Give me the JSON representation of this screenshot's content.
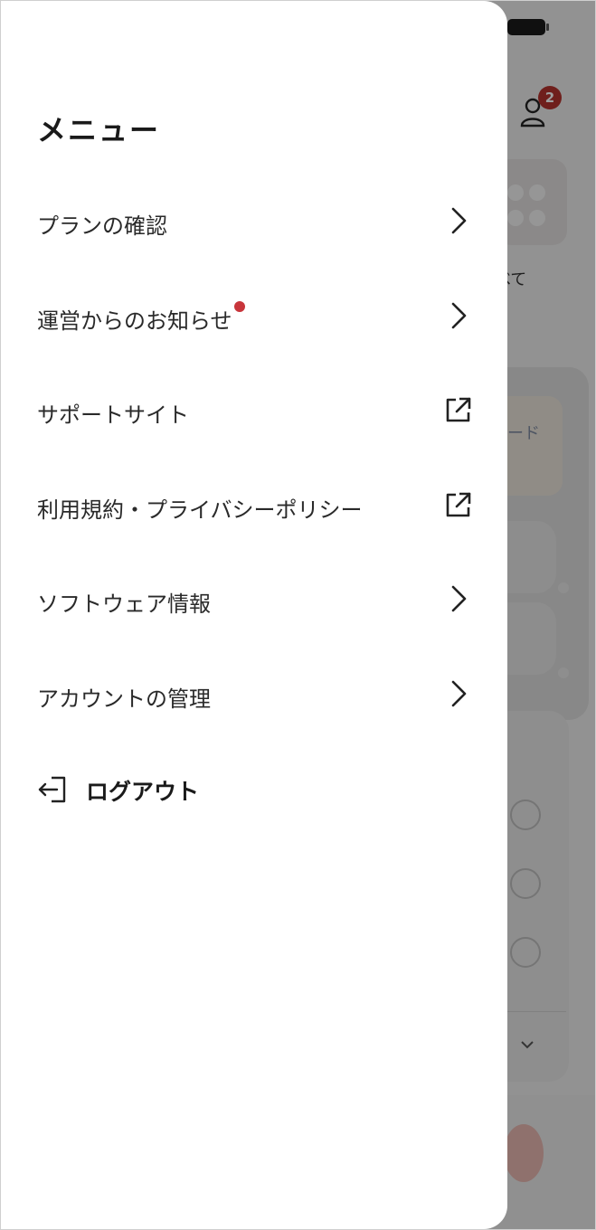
{
  "drawer": {
    "title": "メニュー",
    "items": [
      {
        "label": "プランの確認",
        "icon": "chevron-right-icon",
        "has_badge": false
      },
      {
        "label": "運営からのお知らせ",
        "icon": "chevron-right-icon",
        "has_badge": true
      },
      {
        "label": "サポートサイト",
        "icon": "external-link-icon",
        "has_badge": false
      },
      {
        "label": "利用規約・プライバシーポリシー",
        "icon": "external-link-icon",
        "has_badge": false
      },
      {
        "label": "ソフトウェア情報",
        "icon": "chevron-right-icon",
        "has_badge": false
      },
      {
        "label": "アカウントの管理",
        "icon": "chevron-right-icon",
        "has_badge": false
      }
    ],
    "logout_label": "ログアウト"
  },
  "background": {
    "notification_count": "2",
    "all_label": "べて",
    "card_label": "ード"
  },
  "colors": {
    "badge_red": "#c8353b",
    "overlay": "rgba(0,0,0,0.38)"
  }
}
